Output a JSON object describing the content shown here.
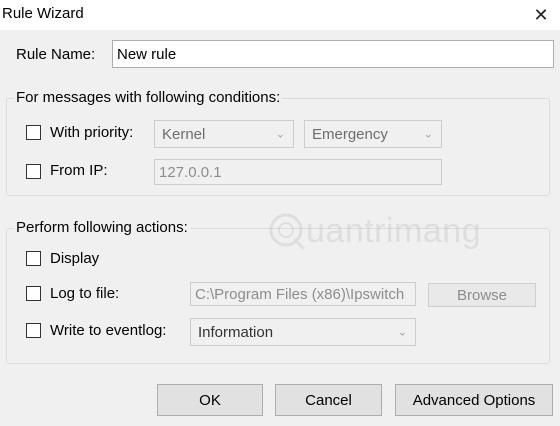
{
  "window": {
    "title": "Rule Wizard",
    "close_glyph": "✕"
  },
  "rule_name": {
    "label": "Rule Name:",
    "value": "New rule"
  },
  "conditions": {
    "group_label": "For messages with following conditions:",
    "priority": {
      "label": "With priority:",
      "checked": false,
      "facility": "Kernel",
      "level": "Emergency"
    },
    "from_ip": {
      "label": "From IP:",
      "checked": false,
      "value": "127.0.0.1"
    }
  },
  "actions": {
    "group_label": "Perform following actions:",
    "display": {
      "label": "Display",
      "checked": false
    },
    "log_to_file": {
      "label": "Log to file:",
      "checked": false,
      "path": "C:\\Program Files (x86)\\Ipswitch",
      "browse_label": "Browse"
    },
    "eventlog": {
      "label": "Write to eventlog:",
      "checked": false,
      "type": "Information"
    }
  },
  "buttons": {
    "ok": "OK",
    "cancel": "Cancel",
    "advanced": "Advanced Options"
  },
  "watermark": {
    "text": "uantrimang"
  },
  "icons": {
    "close": "close-icon",
    "dropdown": "chevron-down-icon",
    "watermark_logo": "quantrimang-logo-icon"
  }
}
